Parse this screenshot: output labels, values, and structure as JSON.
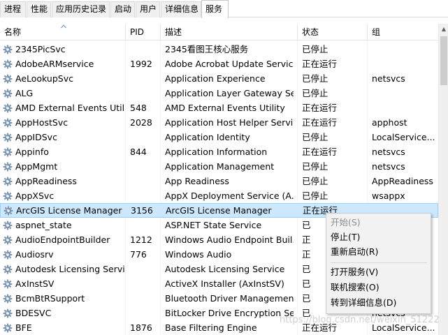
{
  "tabs": [
    {
      "label": "进程"
    },
    {
      "label": "性能"
    },
    {
      "label": "应用历史记录"
    },
    {
      "label": "启动"
    },
    {
      "label": "用户"
    },
    {
      "label": "详细信息"
    },
    {
      "label": "服务"
    }
  ],
  "active_tab": "服务",
  "columns": {
    "name": "名称",
    "pid": "PID",
    "desc": "描述",
    "status": "状态",
    "group": "组"
  },
  "rows": [
    {
      "name": "2345PicSvc",
      "pid": "",
      "desc": "2345看图王核心服务",
      "status": "已停止",
      "group": ""
    },
    {
      "name": "AdobeARMservice",
      "pid": "1992",
      "desc": "Adobe Acrobat Update Service",
      "status": "正在运行",
      "group": ""
    },
    {
      "name": "AeLookupSvc",
      "pid": "",
      "desc": "Application Experience",
      "status": "已停止",
      "group": "netsvcs"
    },
    {
      "name": "ALG",
      "pid": "",
      "desc": "Application Layer Gateway Se...",
      "status": "已停止",
      "group": ""
    },
    {
      "name": "AMD External Events Util...",
      "pid": "548",
      "desc": "AMD External Events Utility",
      "status": "正在运行",
      "group": ""
    },
    {
      "name": "AppHostSvc",
      "pid": "2028",
      "desc": "Application Host Helper Servi...",
      "status": "正在运行",
      "group": "apphost"
    },
    {
      "name": "AppIDSvc",
      "pid": "",
      "desc": "Application Identity",
      "status": "已停止",
      "group": "LocalService..."
    },
    {
      "name": "Appinfo",
      "pid": "844",
      "desc": "Application Information",
      "status": "正在运行",
      "group": "netsvcs"
    },
    {
      "name": "AppMgmt",
      "pid": "",
      "desc": "Application Management",
      "status": "已停止",
      "group": "netsvcs"
    },
    {
      "name": "AppReadiness",
      "pid": "",
      "desc": "App Readiness",
      "status": "已停止",
      "group": "AppReadiness"
    },
    {
      "name": "AppXSvc",
      "pid": "",
      "desc": "AppX Deployment Service (A...",
      "status": "已停止",
      "group": "wsappx"
    },
    {
      "name": "ArcGIS License Manager",
      "pid": "3156",
      "desc": "ArcGIS License Manager",
      "status": "正在运行",
      "group": "",
      "selected": true
    },
    {
      "name": "aspnet_state",
      "pid": "",
      "desc": "ASP.NET State Service",
      "status": "已",
      "group": ""
    },
    {
      "name": "AudioEndpointBuilder",
      "pid": "1212",
      "desc": "Windows Audio Endpoint Buil...",
      "status": "正",
      "group": ""
    },
    {
      "name": "Audiosrv",
      "pid": "776",
      "desc": "Windows Audio",
      "status": "正",
      "group": ""
    },
    {
      "name": "Autodesk Licensing Servi...",
      "pid": "",
      "desc": "Autodesk Licensing Service",
      "status": "已",
      "group": ""
    },
    {
      "name": "AxInstSV",
      "pid": "",
      "desc": "ActiveX Installer (AxInstSV)",
      "status": "已",
      "group": ""
    },
    {
      "name": "BcmBtRSupport",
      "pid": "",
      "desc": "Bluetooth Driver Managemen...",
      "status": "已",
      "group": ""
    },
    {
      "name": "BDESVC",
      "pid": "",
      "desc": "BitLocker Drive Encryption Se...",
      "status": "已",
      "group": "netsvcs"
    },
    {
      "name": "BFE",
      "pid": "1876",
      "desc": "Base Filtering Engine",
      "status": "正在运行",
      "group": "LocalService..."
    }
  ],
  "context_menu": [
    {
      "label": "开始(S)",
      "disabled": true
    },
    {
      "label": "停止(T)",
      "disabled": false
    },
    {
      "label": "重新启动(R)",
      "disabled": false
    },
    {
      "label": "打开服务(V)",
      "disabled": false
    },
    {
      "label": "联机搜索(O)",
      "disabled": false
    },
    {
      "label": "转到详细信息(D)",
      "disabled": false
    }
  ],
  "watermark": "https://blog.csdn.net/weixin_51222",
  "colors": {
    "selected_row": "#cce8ff",
    "selected_border": "#99d1ff",
    "sort_caret": "#3a6ea5"
  },
  "icons": {
    "row_icon": "gear-icon",
    "sort_indicator": "sort-ascending-icon"
  }
}
